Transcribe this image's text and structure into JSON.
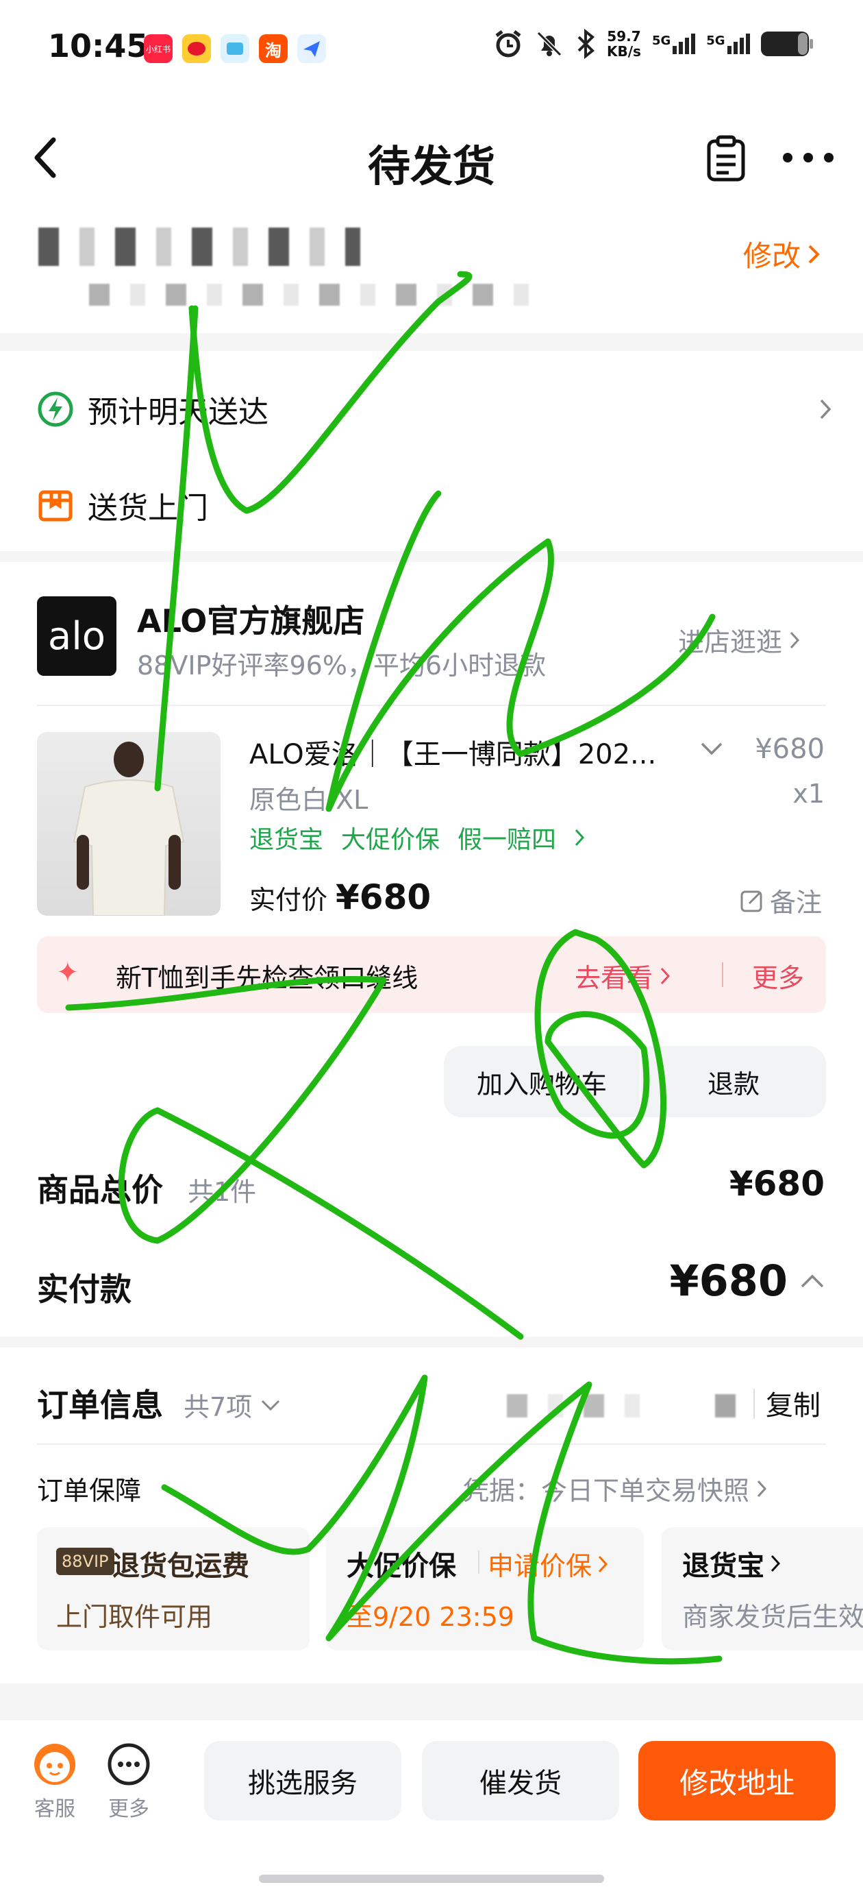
{
  "status_bar": {
    "time": "10:45",
    "app_icons": [
      "xiaohongshu-icon",
      "weibo-icon",
      "app-icon",
      "taobao-icon",
      "feishu-icon"
    ],
    "net_speed_top": "59.7",
    "net_speed_bottom": "KB/s",
    "sim1": "5G",
    "sim2": "5G"
  },
  "header": {
    "title": "待发货",
    "back_icon": "chevron-left-icon",
    "notes_icon": "clipboard-icon",
    "more_icon": "more-horizontal-icon"
  },
  "address": {
    "modify_label": "修改"
  },
  "delivery": {
    "estimate_label": "预计明天送达",
    "door_delivery_label": "送货上门"
  },
  "store": {
    "logo_text": "alo",
    "name": "ALO官方旗舰店",
    "subtitle": "88VIP好评率96%，平均6小时退款",
    "visit_label": "进店逛逛"
  },
  "product": {
    "title": "ALO爱洛｜【王一博同款】202...",
    "spec": "原色白 XL",
    "price": "¥680",
    "qty": "x1",
    "tags": [
      "退货宝",
      "大促价保",
      "假一赔四"
    ],
    "paid_label": "实付价",
    "paid_value": "¥680",
    "remark_label": "备注"
  },
  "tip": {
    "text": "新T恤到手先检查领口缝线",
    "go_label": "去看看",
    "more_label": "更多"
  },
  "actions": {
    "add_cart": "加入购物车",
    "refund": "退款"
  },
  "totals": {
    "total_label": "商品总价",
    "count_label": "共1件",
    "total_value": "¥680",
    "paid_label": "实付款",
    "paid_value": "¥680"
  },
  "order_info": {
    "title": "订单信息",
    "count_label": "共7项",
    "copy_label": "复制",
    "guarantee_label": "订单保障",
    "voucher_label": "凭据：今日下单交易快照"
  },
  "guarantee_cards": [
    {
      "badge": "88VIP",
      "title": "退货包运费",
      "sub": "上门取件可用"
    },
    {
      "title": "大促价保",
      "action": "申请价保",
      "sub": "至9/20 23:59"
    },
    {
      "title": "退货宝",
      "sub": "商家发货后生效"
    }
  ],
  "bottom_bar": {
    "service_label": "客服",
    "more_label": "更多",
    "pick_service": "挑选服务",
    "urge_ship": "催发货",
    "modify_address": "修改地址"
  },
  "colors": {
    "accent_orange": "#ff6a00",
    "green": "#1fa64a",
    "scribble_green": "#22b814",
    "tip_red": "#e84a5f"
  }
}
